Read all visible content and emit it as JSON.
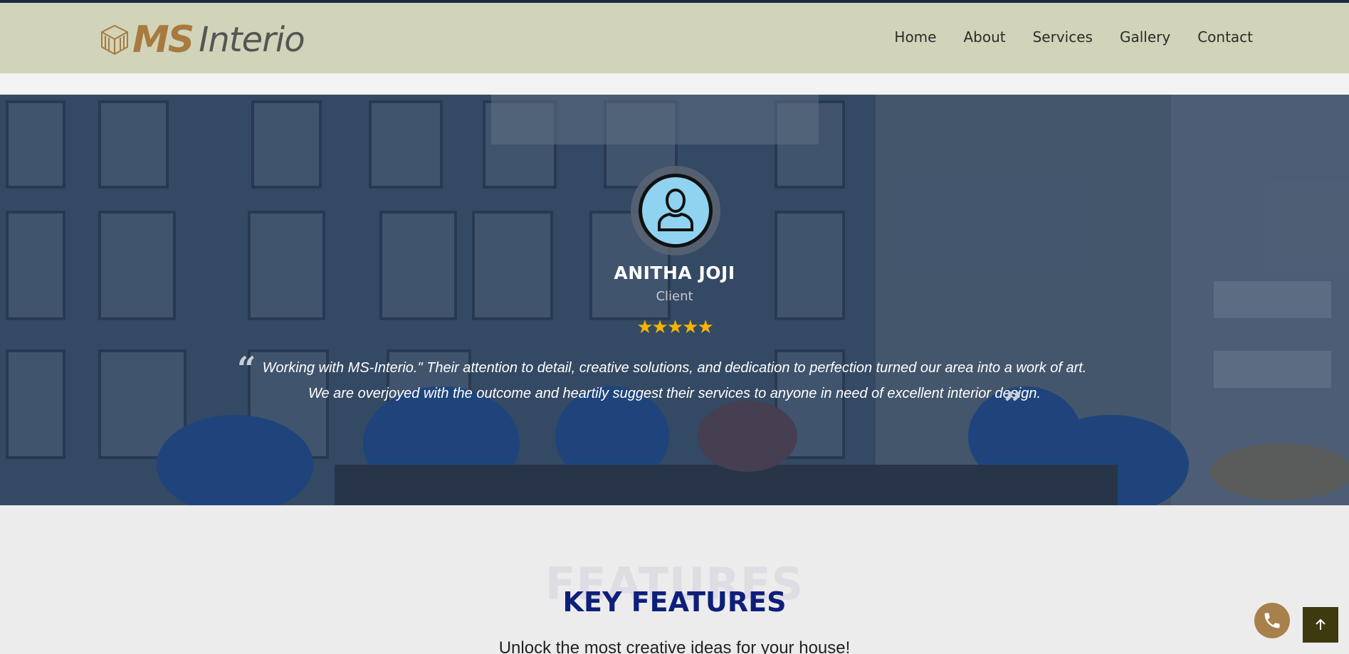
{
  "brand": {
    "logo_ms": "MS",
    "logo_interio": "Interio"
  },
  "nav": {
    "items": [
      "Home",
      "About",
      "Services",
      "Gallery",
      "Contact"
    ]
  },
  "testimonial": {
    "name": "ANITHA JOJI",
    "role": "Client",
    "rating": 5,
    "stars": "★★★★★",
    "open_quote": "“",
    "close_quote": "”",
    "text": "Working with MS-Interio.\" Their attention to detail, creative solutions, and dedication to perfection turned our area into a work of art. We are overjoyed with the outcome and heartily suggest their services to anyone in need of excellent interior design."
  },
  "features": {
    "background_word": "FEATURES",
    "title": "KEY FEATURES",
    "subtitle": "Unlock the most creative ideas for your house!"
  },
  "floating": {
    "call_icon": "phone-icon",
    "top_icon": "arrow-up-icon"
  },
  "colors": {
    "header_bg": "#d1d4b8",
    "accent": "#a87a3e",
    "title": "#0e1f7a",
    "star": "#f4b400",
    "back_to_top": "#3c3a0e"
  }
}
